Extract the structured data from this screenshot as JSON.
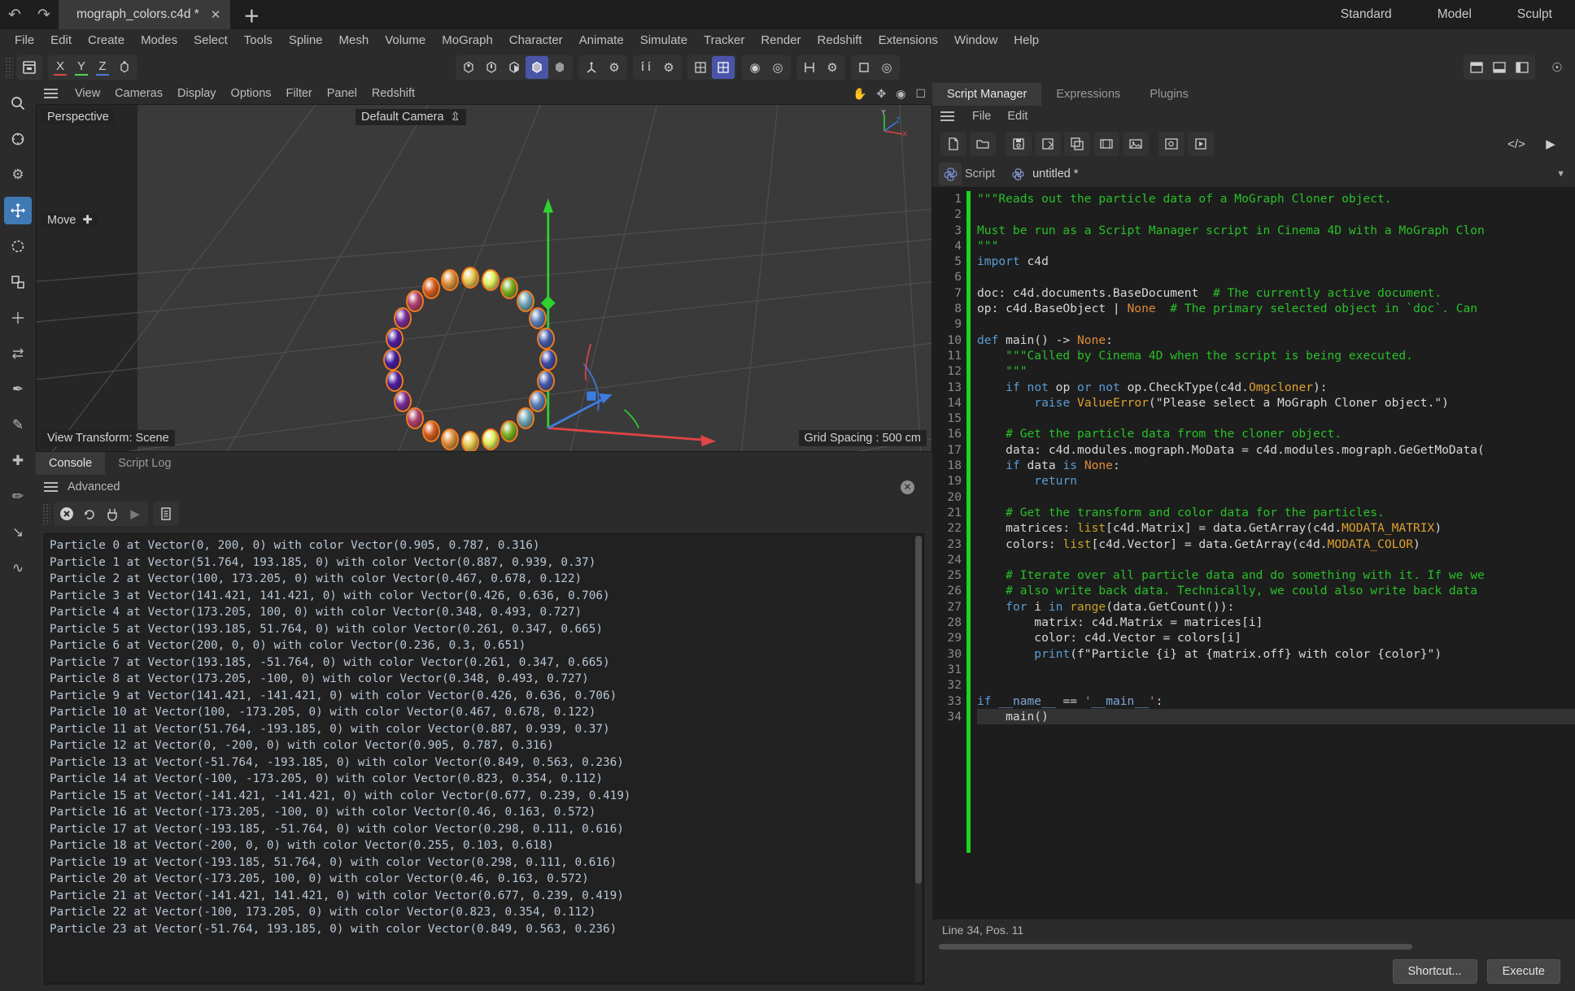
{
  "titlebar": {
    "undo_icon": "undo-arrow-icon",
    "redo_icon": "redo-arrow-icon",
    "document_tab": "mograph_colors.c4d *",
    "close_label": "✕",
    "new_tab_label": "＋",
    "layouts": [
      "Standard",
      "Model",
      "Sculpt"
    ]
  },
  "menubar": {
    "items": [
      "File",
      "Edit",
      "Create",
      "Modes",
      "Select",
      "Tools",
      "Spline",
      "Mesh",
      "Volume",
      "MoGraph",
      "Character",
      "Animate",
      "Simulate",
      "Tracker",
      "Render",
      "Redshift",
      "Extensions",
      "Window",
      "Help"
    ]
  },
  "toolbar": {
    "axis_labels": [
      "X",
      "Y",
      "Z"
    ],
    "axis_colors": [
      "#d84a4a",
      "#4ad84a",
      "#4a7ad8"
    ],
    "selected_mode_color": "#4a55a8"
  },
  "viewport": {
    "menu": [
      "View",
      "Cameras",
      "Display",
      "Options",
      "Filter",
      "Panel",
      "Redshift"
    ],
    "perspective_label": "Perspective",
    "camera_label": "Default Camera",
    "tool_label": "Move",
    "view_transform": "View Transform: Scene",
    "grid_spacing": "Grid Spacing : 500 cm",
    "axis_x_label": "X",
    "axis_y_label": "Y",
    "axis_z_label": "Z"
  },
  "console": {
    "tabs": [
      "Console",
      "Script Log"
    ],
    "active_tab": "Console",
    "mode_label": "Advanced",
    "lines": [
      "Particle 0 at Vector(0, 200, 0) with color Vector(0.905, 0.787, 0.316)",
      "Particle 1 at Vector(51.764, 193.185, 0) with color Vector(0.887, 0.939, 0.37)",
      "Particle 2 at Vector(100, 173.205, 0) with color Vector(0.467, 0.678, 0.122)",
      "Particle 3 at Vector(141.421, 141.421, 0) with color Vector(0.426, 0.636, 0.706)",
      "Particle 4 at Vector(173.205, 100, 0) with color Vector(0.348, 0.493, 0.727)",
      "Particle 5 at Vector(193.185, 51.764, 0) with color Vector(0.261, 0.347, 0.665)",
      "Particle 6 at Vector(200, 0, 0) with color Vector(0.236, 0.3, 0.651)",
      "Particle 7 at Vector(193.185, -51.764, 0) with color Vector(0.261, 0.347, 0.665)",
      "Particle 8 at Vector(173.205, -100, 0) with color Vector(0.348, 0.493, 0.727)",
      "Particle 9 at Vector(141.421, -141.421, 0) with color Vector(0.426, 0.636, 0.706)",
      "Particle 10 at Vector(100, -173.205, 0) with color Vector(0.467, 0.678, 0.122)",
      "Particle 11 at Vector(51.764, -193.185, 0) with color Vector(0.887, 0.939, 0.37)",
      "Particle 12 at Vector(0, -200, 0) with color Vector(0.905, 0.787, 0.316)",
      "Particle 13 at Vector(-51.764, -193.185, 0) with color Vector(0.849, 0.563, 0.236)",
      "Particle 14 at Vector(-100, -173.205, 0) with color Vector(0.823, 0.354, 0.112)",
      "Particle 15 at Vector(-141.421, -141.421, 0) with color Vector(0.677, 0.239, 0.419)",
      "Particle 16 at Vector(-173.205, -100, 0) with color Vector(0.46, 0.163, 0.572)",
      "Particle 17 at Vector(-193.185, -51.764, 0) with color Vector(0.298, 0.111, 0.616)",
      "Particle 18 at Vector(-200, 0, 0) with color Vector(0.255, 0.103, 0.618)",
      "Particle 19 at Vector(-193.185, 51.764, 0) with color Vector(0.298, 0.111, 0.616)",
      "Particle 20 at Vector(-173.205, 100, 0) with color Vector(0.46, 0.163, 0.572)",
      "Particle 21 at Vector(-141.421, 141.421, 0) with color Vector(0.677, 0.239, 0.419)",
      "Particle 22 at Vector(-100, 173.205, 0) with color Vector(0.823, 0.354, 0.112)",
      "Particle 23 at Vector(-51.764, 193.185, 0) with color Vector(0.849, 0.563, 0.236)"
    ]
  },
  "script_manager": {
    "tabs": [
      "Script Manager",
      "Expressions",
      "Plugins"
    ],
    "active_tab": "Script Manager",
    "menu": [
      "File",
      "Edit"
    ],
    "script_label": "Script",
    "script_name": "untitled *",
    "status": "Line 34, Pos. 11",
    "buttons": {
      "shortcut": "Shortcut...",
      "execute": "Execute"
    },
    "code_lines": [
      "\"\"\"Reads out the particle data of a MoGraph Cloner object.",
      "",
      "Must be run as a Script Manager script in Cinema 4D with a MoGraph Clon",
      "\"\"\"",
      "import c4d",
      "",
      "doc: c4d.documents.BaseDocument  # The currently active document.",
      "op: c4d.BaseObject | None  # The primary selected object in `doc`. Can",
      "",
      "def main() -> None:",
      "    \"\"\"Called by Cinema 4D when the script is being executed.",
      "    \"\"\"",
      "    if not op or not op.CheckType(c4d.Omgcloner):",
      "        raise ValueError(\"Please select a MoGraph Cloner object.\")",
      "",
      "    # Get the particle data from the cloner object.",
      "    data: c4d.modules.mograph.MoData = c4d.modules.mograph.GeGetMoData(",
      "    if data is None:",
      "        return",
      "",
      "    # Get the transform and color data for the particles.",
      "    matrices: list[c4d.Matrix] = data.GetArray(c4d.MODATA_MATRIX)",
      "    colors: list[c4d.Vector] = data.GetArray(c4d.MODATA_COLOR)",
      "",
      "    # Iterate over all particle data and do something with it. If we we",
      "    # also write back data. Technically, we could also write back data",
      "    for i in range(data.GetCount()):",
      "        matrix: c4d.Matrix = matrices[i]",
      "        color: c4d.Vector = colors[i]",
      "        print(f\"Particle {i} at {matrix.off} with color {color}\")",
      "",
      "",
      "if __name__ == '__main__':",
      "    main()"
    ]
  },
  "scene_particles": [
    {
      "index": 0,
      "color": "#e7c951"
    },
    {
      "index": 1,
      "color": "#e2ef5e"
    },
    {
      "index": 2,
      "color": "#77ad1f"
    },
    {
      "index": 3,
      "color": "#6ca2b4"
    },
    {
      "index": 4,
      "color": "#597ebb"
    },
    {
      "index": 5,
      "color": "#4258a9"
    },
    {
      "index": 6,
      "color": "#3c4ca6"
    },
    {
      "index": 7,
      "color": "#4258a9"
    },
    {
      "index": 8,
      "color": "#597ebb"
    },
    {
      "index": 9,
      "color": "#6ca2b4"
    },
    {
      "index": 10,
      "color": "#77ad1f"
    },
    {
      "index": 11,
      "color": "#e2ef5e"
    },
    {
      "index": 12,
      "color": "#e7c951"
    },
    {
      "index": 13,
      "color": "#d9903c"
    },
    {
      "index": 14,
      "color": "#d25a1c"
    },
    {
      "index": 15,
      "color": "#ad3d6b"
    },
    {
      "index": 16,
      "color": "#752992"
    },
    {
      "index": 17,
      "color": "#4c1c9d"
    },
    {
      "index": 18,
      "color": "#411a9e"
    },
    {
      "index": 19,
      "color": "#4c1c9d"
    },
    {
      "index": 20,
      "color": "#752992"
    },
    {
      "index": 21,
      "color": "#ad3d6b"
    },
    {
      "index": 22,
      "color": "#d25a1c"
    },
    {
      "index": 23,
      "color": "#d9903c"
    }
  ]
}
